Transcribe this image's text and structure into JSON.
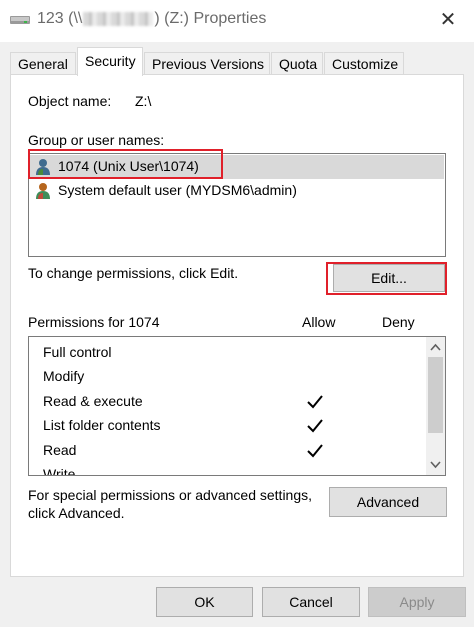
{
  "window": {
    "title_prefix": "123 (\\\\",
    "title_suffix": ") (Z:) Properties",
    "close_glyph": "✕"
  },
  "tabs": [
    {
      "label": "General"
    },
    {
      "label": "Security"
    },
    {
      "label": "Previous Versions"
    },
    {
      "label": "Quota"
    },
    {
      "label": "Customize"
    }
  ],
  "security": {
    "object_name_label": "Object name:",
    "object_name_value": "Z:\\",
    "group_label": "Group or user names:",
    "users": [
      {
        "name": "1074 (Unix User\\1074)"
      },
      {
        "name": "System default user (MYDSM6\\admin)"
      }
    ],
    "change_text": "To change permissions, click Edit.",
    "edit_button": "Edit...",
    "permissions_for": "Permissions for 1074",
    "allow_header": "Allow",
    "deny_header": "Deny",
    "permissions": [
      {
        "name": "Full control",
        "allow": false,
        "deny": false
      },
      {
        "name": "Modify",
        "allow": false,
        "deny": false
      },
      {
        "name": "Read & execute",
        "allow": true,
        "deny": false
      },
      {
        "name": "List folder contents",
        "allow": true,
        "deny": false
      },
      {
        "name": "Read",
        "allow": true,
        "deny": false
      },
      {
        "name": "Write",
        "allow": false,
        "deny": false
      }
    ],
    "special_text_line1": "For special permissions or advanced settings,",
    "special_text_line2": "click Advanced.",
    "advanced_button": "Advanced"
  },
  "footer": {
    "ok": "OK",
    "cancel": "Cancel",
    "apply": "Apply"
  },
  "colors": {
    "highlight": "#e0202a",
    "selection": "#d9d9d9"
  },
  "icons": {
    "title": "drive-icon",
    "user": "user-icon",
    "check": "checkmark-icon"
  }
}
